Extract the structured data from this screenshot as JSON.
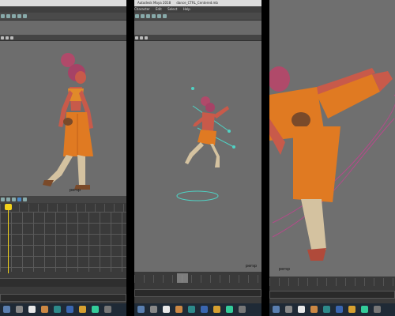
{
  "panel1": {
    "persp_label": "persp"
  },
  "panel2": {
    "window_title": "Autodesk Maya 2018",
    "file_name": "dance_CTRL_Centered.mb",
    "menu_items": [
      "Character",
      "Edit",
      "Select",
      "Help"
    ],
    "persp_label": "persp"
  },
  "panel3": {
    "persp_label": "persp"
  },
  "colors": {
    "maya_bg": "#6b6b6b",
    "skin": "#c85a4a",
    "dress": "#e07a22",
    "hair": "#b04a6a",
    "timeline_marker": "#f2d21b",
    "curve": "#b44b8a",
    "taskbar": "#1f2a36"
  }
}
